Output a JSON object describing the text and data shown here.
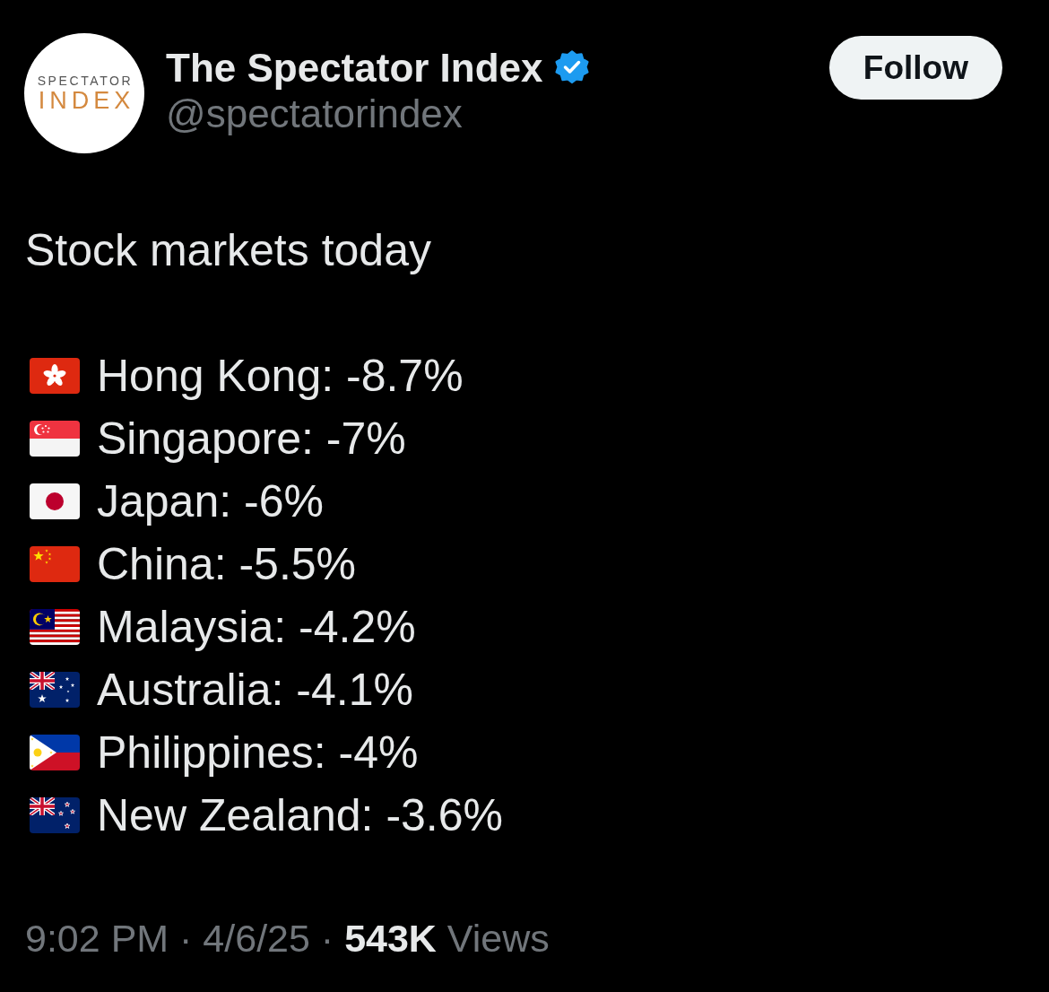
{
  "author": {
    "avatar_logo": [
      "SPECTATOR",
      "INDEX"
    ],
    "name": "The Spectator Index",
    "verified": true,
    "handle": "@spectatorindex"
  },
  "follow_button": {
    "label": "Follow"
  },
  "tweet": {
    "text": "Stock markets today",
    "markets": [
      {
        "kind": "hk",
        "text": "Hong Kong: -8.7%"
      },
      {
        "kind": "sg",
        "text": "Singapore: -7%"
      },
      {
        "kind": "jp",
        "text": "Japan: -6%"
      },
      {
        "kind": "cn",
        "text": "China: -5.5%"
      },
      {
        "kind": "my",
        "text": "Malaysia: -4.2%"
      },
      {
        "kind": "au",
        "text": "Australia: -4.1%"
      },
      {
        "kind": "ph",
        "text": "Philippines: -4%"
      },
      {
        "kind": "nz",
        "text": "New Zealand: -3.6%"
      }
    ]
  },
  "meta": "9:02 PM · 4/6/25 · **543K** Views"
}
